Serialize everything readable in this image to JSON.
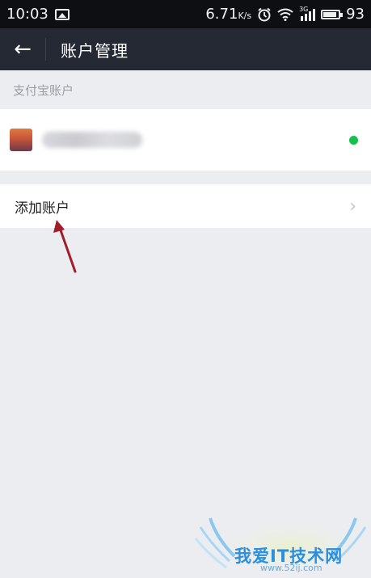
{
  "statusbar": {
    "time": "10:03",
    "speed_value": "6.71",
    "speed_unit": "K/s",
    "network_type": "3G",
    "battery_level": "93"
  },
  "appbar": {
    "back_label": "←",
    "title": "账户管理"
  },
  "section": {
    "header": "支付宝账户"
  },
  "account": {
    "status_color": "#14c24a"
  },
  "add_account": {
    "label": "添加账户",
    "chevron": "›"
  },
  "watermark": {
    "text": "我爱IT技术网",
    "url": "www.52ij.com"
  },
  "colors": {
    "appbar_bg": "#252934",
    "page_bg": "#ecedf1",
    "annotation_arrow": "#a11d2b"
  }
}
